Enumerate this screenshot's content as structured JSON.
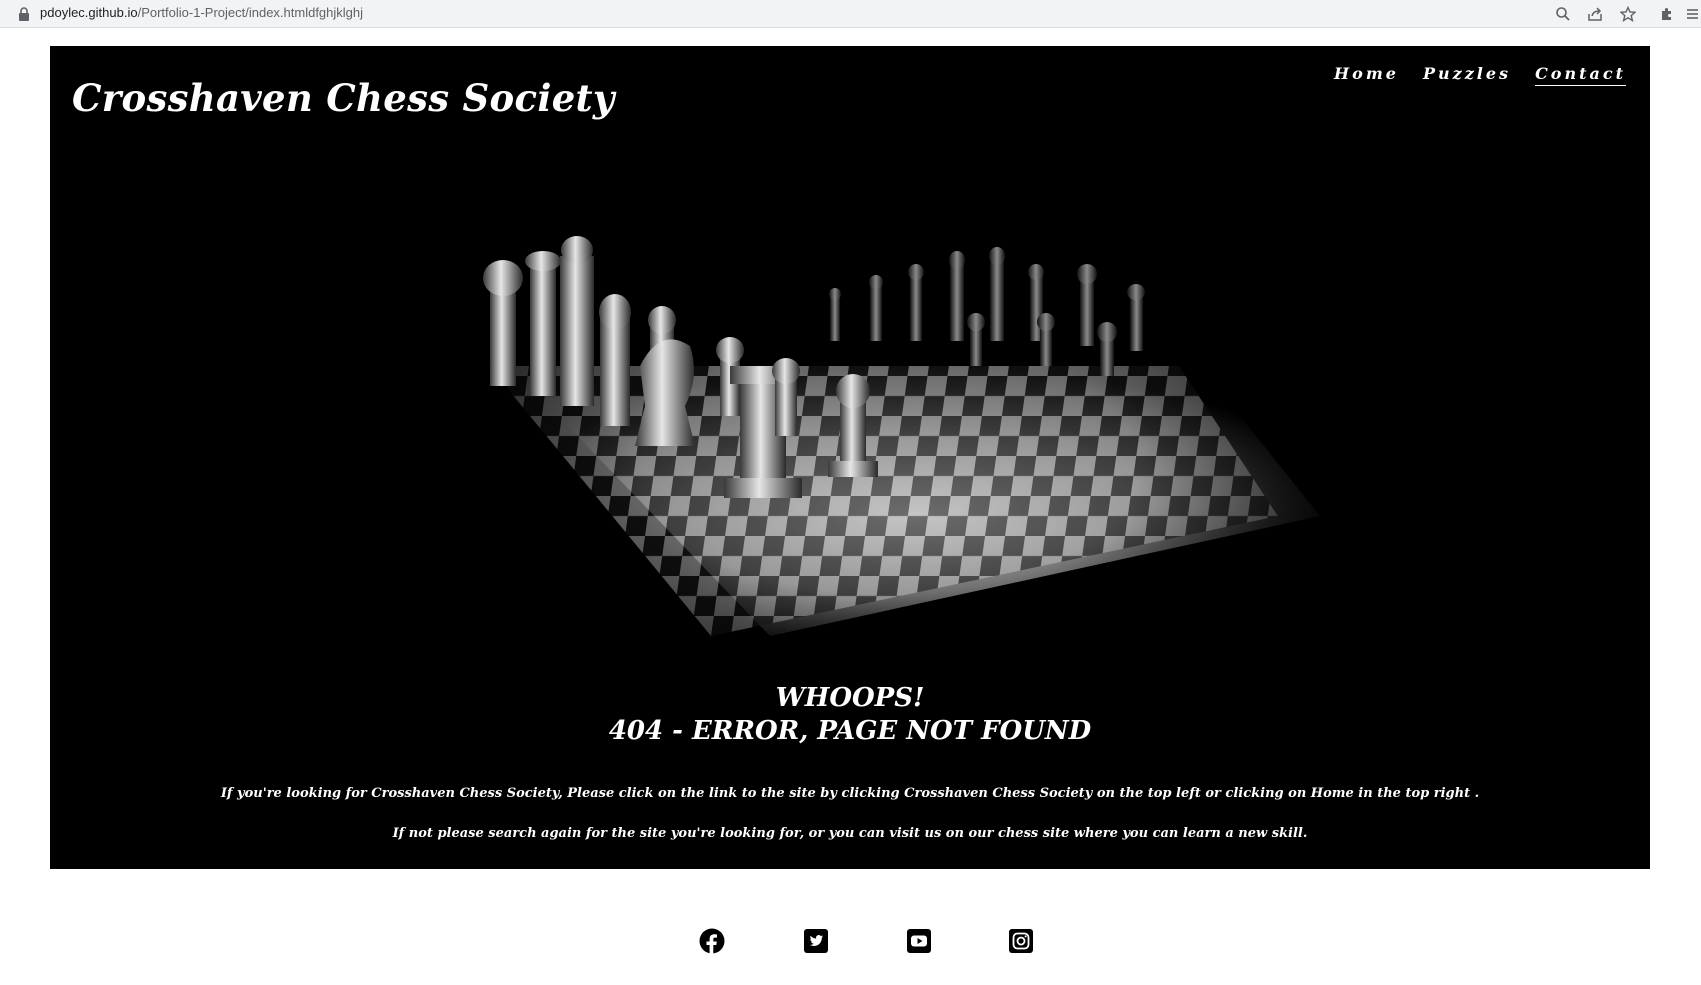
{
  "browser": {
    "url_domain": "pdoylec.github.io",
    "url_path": "/Portfolio-1-Project/index.htmldfghjklghj",
    "icons": [
      "lock-icon",
      "zoom-icon",
      "share-icon",
      "bookmark-star-icon",
      "extensions-icon",
      "menu-icon"
    ]
  },
  "site": {
    "title": "Crosshaven Chess Society"
  },
  "nav": {
    "items": [
      {
        "label": "Home"
      },
      {
        "label": "Puzzles"
      },
      {
        "label": "Contact"
      }
    ],
    "active": "Contact"
  },
  "error": {
    "line1": "WHOOPS!",
    "line2": "404 - ERROR, PAGE NOT FOUND",
    "message1": "If you're looking for Crosshaven Chess Society, Please click on the link to the site by clicking Crosshaven Chess Society on the top left or clicking on Home in the top right .",
    "message2": "If not please search again for the site you're looking for, or you can visit us on our chess site where you can learn a new skill."
  },
  "footer": {
    "social": [
      "facebook-icon",
      "twitter-icon",
      "youtube-icon",
      "instagram-icon"
    ]
  },
  "colors": {
    "hero_bg": "#000000",
    "text_light": "#ffffff",
    "page_bg": "#ffffff"
  }
}
